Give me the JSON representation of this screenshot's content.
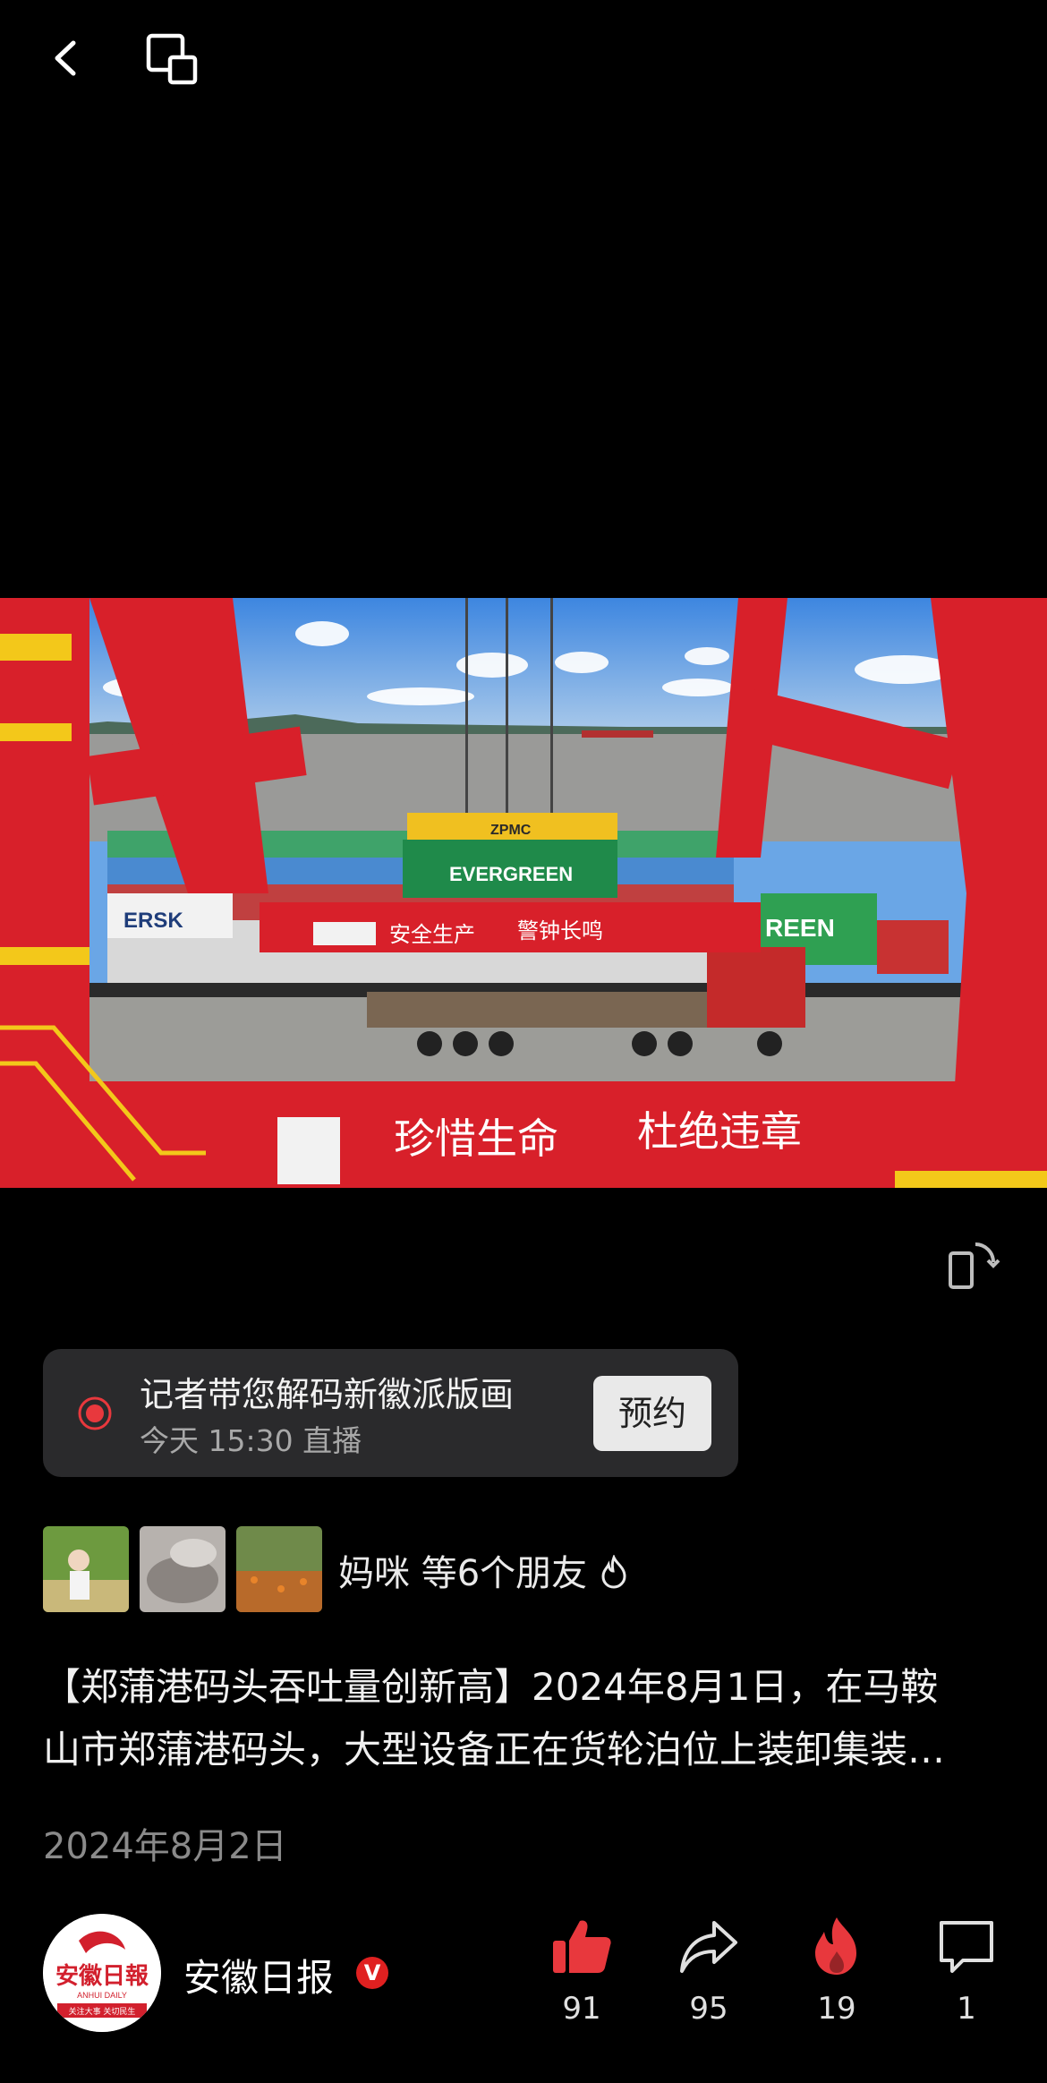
{
  "top_bar": {
    "back_icon": "chevron-left-icon",
    "screen_icon": "cast-screen-icon"
  },
  "video": {
    "overlay_texts": {
      "banner_top_left": "安全生产",
      "banner_top_right": "警钟长鸣",
      "banner_bottom_left": "珍惜生命",
      "banner_bottom_right": "杜绝违章",
      "container_brand": "EVERGREEN",
      "spreader_brand": "ZPMC",
      "container_left": "ERSK",
      "container_right": "REEN"
    }
  },
  "rotate_icon": "rotate-screen-icon",
  "live_card": {
    "title": "记者带您解码新徽派版画",
    "time": "今天 15:30 直播",
    "button": "预约",
    "accent": "#e8383d"
  },
  "friends": {
    "text": "妈咪 等6个朋友"
  },
  "post": {
    "line1": "【郑蒲港码头吞吐量创新高】2024年8月1日，在马鞍",
    "line2": "山市郑蒲港码头，大型设备正在货轮泊位上装卸集装…",
    "date": "2024年8月2日"
  },
  "account": {
    "name": "安徽日报",
    "verified": "V",
    "logo_text": "安徽日報",
    "logo_subtext": "ANHUI DAILY",
    "logo_slogan": "关注大事 关切民生"
  },
  "actions": {
    "like": "91",
    "share": "95",
    "hot": "19",
    "comment": "1"
  },
  "colors": {
    "like": "#e8383d",
    "hot": "#e8383d",
    "brand_red": "#d2202d"
  }
}
